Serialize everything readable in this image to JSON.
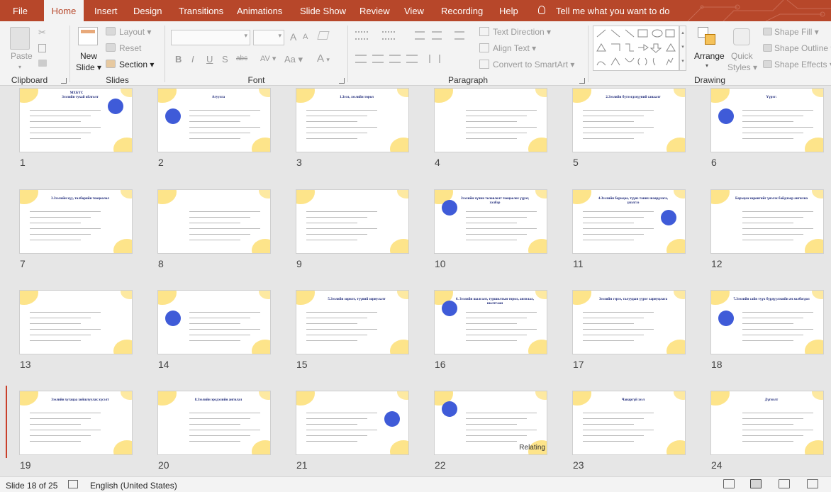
{
  "tabs": [
    "File",
    "Home",
    "Insert",
    "Design",
    "Transitions",
    "Animations",
    "Slide Show",
    "Review",
    "View",
    "Recording",
    "Help"
  ],
  "active_tab": "Home",
  "tell_me": "Tell me what you want to do",
  "ribbon": {
    "clipboard": {
      "paste": "Paste",
      "label": "Clipboard"
    },
    "slides": {
      "new_slide_1": "New",
      "new_slide_2": "Slide",
      "layout": "Layout",
      "reset": "Reset",
      "section": "Section",
      "label": "Slides"
    },
    "font": {
      "label": "Font",
      "bold": "B",
      "italic": "I",
      "underline": "U",
      "strike": "S",
      "abc": "abc",
      "spacing": "AV",
      "case": "Aa",
      "color_a": "A",
      "grow": "A",
      "shrink": "A"
    },
    "paragraph": {
      "text_direction": "Text Direction",
      "align_text": "Align Text",
      "smartart": "Convert to SmartArt",
      "label": "Paragraph"
    },
    "drawing": {
      "arrange": "Arrange",
      "quick_styles_1": "Quick",
      "quick_styles_2": "Styles",
      "shape_fill": "Shape Fill",
      "shape_outline": "Shape Outline",
      "shape_effects": "Shape Effects",
      "label": "Drawing"
    }
  },
  "slides": [
    {
      "n": "1",
      "title": "Зээлийн тухай ойлголт",
      "sub": "МХБҮС"
    },
    {
      "n": "2",
      "title": "Агуулга"
    },
    {
      "n": "3",
      "title": "1.Зээл, зээлийн төрөл"
    },
    {
      "n": "4",
      "title": ""
    },
    {
      "n": "5",
      "title": "2.Зээлийн бүтээгдэхүүний санаалт"
    },
    {
      "n": "6",
      "title": "Үүрэг:"
    },
    {
      "n": "7",
      "title": "3.Зээлийн хүү, төлбөрийн тооцоолол"
    },
    {
      "n": "8",
      "title": ""
    },
    {
      "n": "9",
      "title": ""
    },
    {
      "n": "10",
      "title": "Зээлийн хүчин төлөвлөлт тооцоолох үүрэг, хэлбэр"
    },
    {
      "n": "11",
      "title": "4.Зээлийн барьцаа, түүнз таних шаардлага, үнэлгээ"
    },
    {
      "n": "12",
      "title": "Барьцаа хөрөнгийг үнэлэх байдлаар ангилна"
    },
    {
      "n": "13",
      "title": ""
    },
    {
      "n": "14",
      "title": ""
    },
    {
      "n": "15",
      "title": "5.Зээлийн зорилт, түүний зориулалт"
    },
    {
      "n": "16",
      "title": "6. Зээлийн шалгалт, туршилтын төрөл, ангилал, шалтгаан"
    },
    {
      "n": "17",
      "title": "Зээлийн гэрээ, талуудын үүрэг хариуцлага"
    },
    {
      "n": "18",
      "title": "7.Зээлийн сайн түүх бүрдүүлэхийн ач холбогдол"
    },
    {
      "n": "19",
      "title": "Зээлийн хугацаа хойшлуулах хүсэлт"
    },
    {
      "n": "20",
      "title": "8.Зээлийн эрсдэлийн ангилал"
    },
    {
      "n": "21",
      "title": ""
    },
    {
      "n": "22",
      "title": "",
      "extra": "Relating"
    },
    {
      "n": "23",
      "title": "Чанаргүй зээл"
    },
    {
      "n": "24",
      "title": "Дүгнэлт"
    }
  ],
  "selected_slide": "18",
  "status": {
    "slide_info": "Slide 18 of 25",
    "language": "English (United States)"
  },
  "colors": {
    "accent": "#b7472a",
    "slide_yellow": "#fde48a",
    "slide_blue": "#3f5bd8"
  }
}
